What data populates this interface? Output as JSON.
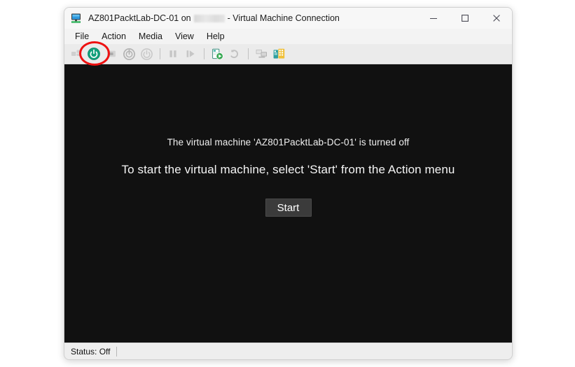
{
  "window": {
    "title_prefix": "AZ801PacktLab-DC-01 on",
    "title_suffix": "- Virtual Machine Connection",
    "host_redacted": "",
    "icon": "vm-connection-icon"
  },
  "window_controls": [
    {
      "name": "minimize",
      "glyph": "minimize-icon"
    },
    {
      "name": "maximize",
      "glyph": "maximize-icon"
    },
    {
      "name": "close",
      "glyph": "close-icon"
    }
  ],
  "menubar": {
    "items": [
      {
        "label": "File"
      },
      {
        "label": "Action"
      },
      {
        "label": "Media"
      },
      {
        "label": "View"
      },
      {
        "label": "Help"
      }
    ]
  },
  "toolbar": {
    "buttons": [
      {
        "name": "ctrl-alt-delete-icon",
        "state": "disabled"
      },
      {
        "name": "start-power-icon",
        "state": "enabled",
        "color": "#14a07c"
      },
      {
        "name": "turn-off-icon",
        "state": "disabled"
      },
      {
        "name": "shut-down-icon",
        "state": "disabled"
      },
      {
        "name": "save-state-icon",
        "state": "disabled"
      },
      {
        "name": "pause-icon",
        "state": "disabled"
      },
      {
        "name": "resume-icon",
        "state": "disabled"
      },
      {
        "name": "checkpoint-icon",
        "state": "enabled"
      },
      {
        "name": "revert-icon",
        "state": "disabled"
      },
      {
        "name": "enhanced-session-icon",
        "state": "disabled"
      },
      {
        "name": "vm-settings-icon",
        "state": "enabled"
      }
    ]
  },
  "viewport": {
    "line1": "The virtual machine 'AZ801PacktLab-DC-01' is turned off",
    "line2": "To start the virtual machine, select 'Start' from the Action menu",
    "start_button": "Start",
    "background": "#111111"
  },
  "statusbar": {
    "status": "Status: Off"
  },
  "annotation": {
    "shape": "ellipse",
    "color": "#ee1111",
    "target": "start-power-icon"
  }
}
